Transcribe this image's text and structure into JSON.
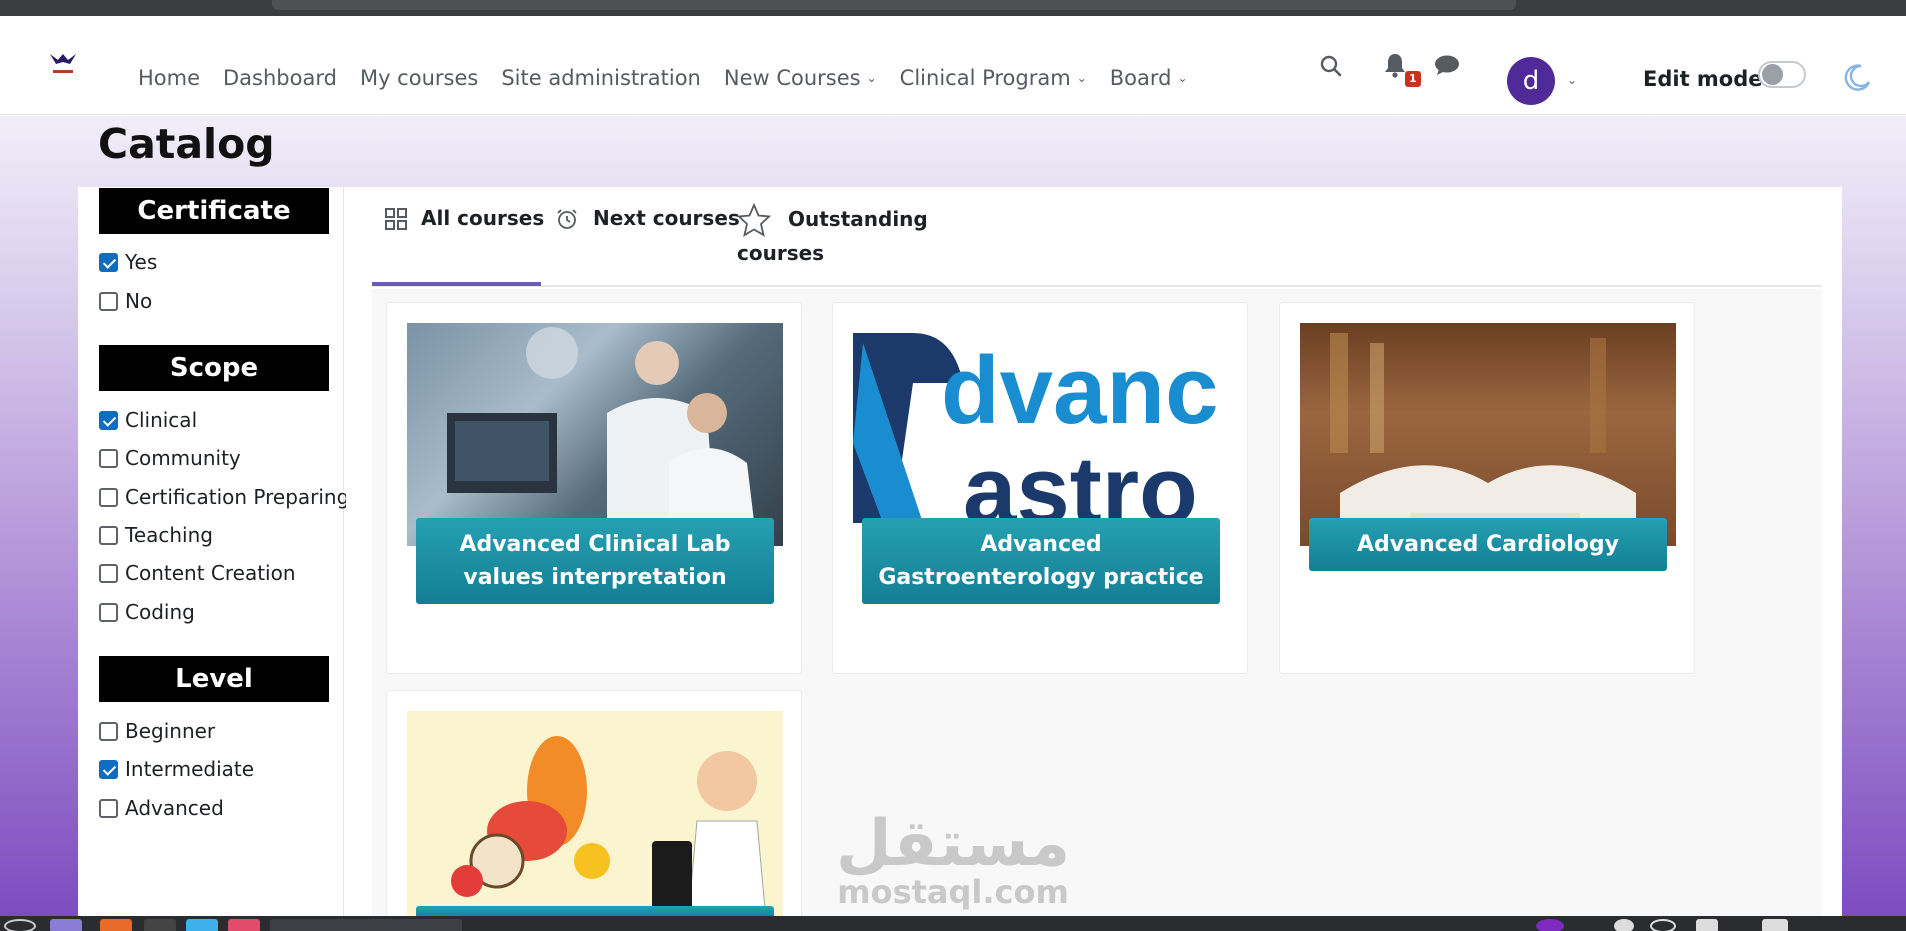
{
  "nav": {
    "links": [
      {
        "label": "Home",
        "has_dropdown": false
      },
      {
        "label": "Dashboard",
        "has_dropdown": false
      },
      {
        "label": "My courses",
        "has_dropdown": false
      },
      {
        "label": "Site administration",
        "has_dropdown": false
      },
      {
        "label": "New Courses",
        "has_dropdown": true
      },
      {
        "label": "Clinical Program",
        "has_dropdown": true
      },
      {
        "label": "Board",
        "has_dropdown": true
      }
    ],
    "notification_count": "1",
    "avatar_letter": "d",
    "edit_mode_label": "Edit mode",
    "edit_mode_on": false
  },
  "page": {
    "title": "Catalog"
  },
  "filters": {
    "certificate": {
      "heading": "Certificate",
      "options": [
        {
          "label": "Yes",
          "checked": true
        },
        {
          "label": "No",
          "checked": false
        }
      ]
    },
    "scope": {
      "heading": "Scope",
      "options": [
        {
          "label": "Clinical",
          "checked": true
        },
        {
          "label": "Community",
          "checked": false
        },
        {
          "label": "Certification Preparing",
          "checked": false
        },
        {
          "label": "Teaching",
          "checked": false
        },
        {
          "label": "Content Creation",
          "checked": false
        },
        {
          "label": "Coding",
          "checked": false
        }
      ]
    },
    "level": {
      "heading": "Level",
      "options": [
        {
          "label": "Beginner",
          "checked": false
        },
        {
          "label": "Intermediate",
          "checked": true
        },
        {
          "label": "Advanced",
          "checked": false
        }
      ]
    }
  },
  "tabs": [
    {
      "label": "All courses",
      "active": true,
      "icon": "grid-icon"
    },
    {
      "label": "Next courses",
      "active": false,
      "icon": "alarm-clock-icon"
    },
    {
      "label": "Outstanding courses",
      "active": false,
      "icon": "star-icon"
    }
  ],
  "courses": [
    {
      "title": "Advanced Clinical Lab values interpretation",
      "image": "lab-scientists-image"
    },
    {
      "title": "Advanced Gastroenterology practice",
      "image": "advanced-gastro-logo-image",
      "image_text": "dvanc astro"
    },
    {
      "title": "Advanced Cardiology",
      "image": "open-book-library-image"
    },
    {
      "title": "",
      "image": "nutrition-doctor-fruits-image"
    }
  ],
  "watermark": {
    "arabic": "مستقل",
    "latin": "mostaql.com"
  },
  "colors": {
    "accent": "#6a5bb5",
    "card_title_bg": "#1a8ea3",
    "avatar_bg": "#4f2a98",
    "badge": "#ca3120",
    "checkbox": "#0f6cbf"
  }
}
